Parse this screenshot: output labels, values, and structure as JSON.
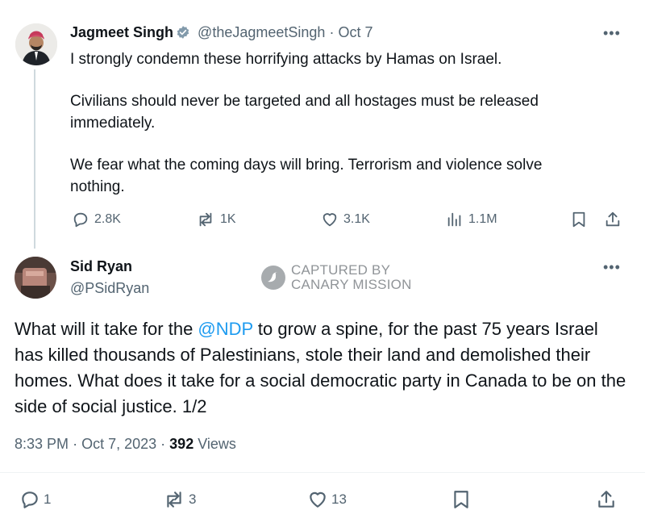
{
  "tweet1": {
    "author_name": "Jagmeet Singh",
    "handle": "@theJagmeetSingh",
    "separator": "·",
    "date": "Oct 7",
    "paragraphs": [
      "I strongly condemn these horrifying attacks by Hamas on Israel.",
      "Civilians should never be targeted and all hostages must be released immediately.",
      "We fear what the coming days will bring. Terrorism and violence solve nothing."
    ],
    "stats": {
      "replies": "2.8K",
      "reposts": "1K",
      "likes": "3.1K",
      "views": "1.1M"
    }
  },
  "tweet2": {
    "author_name": "Sid Ryan",
    "handle": "@PSidRyan",
    "text_before": "What will it take for the ",
    "mention": "@NDP",
    "text_after": " to grow a spine, for the past 75 years Israel has killed thousands of Palestinians, stole their land and demolished their homes. What does it take for a social democratic party in Canada to be on the side of social justice. 1/2",
    "time": "8:33 PM",
    "date": "Oct 7, 2023",
    "separator": "·",
    "views_count": "392",
    "views_label": "Views",
    "stats": {
      "replies": "1",
      "reposts": "3",
      "likes": "13"
    }
  },
  "watermark": {
    "line1": "CAPTURED BY",
    "line2": "CANARY MISSION"
  },
  "colors": {
    "link": "#1d9bf0",
    "muted": "#536471",
    "text": "#0f1419",
    "verified": "#829aab"
  }
}
